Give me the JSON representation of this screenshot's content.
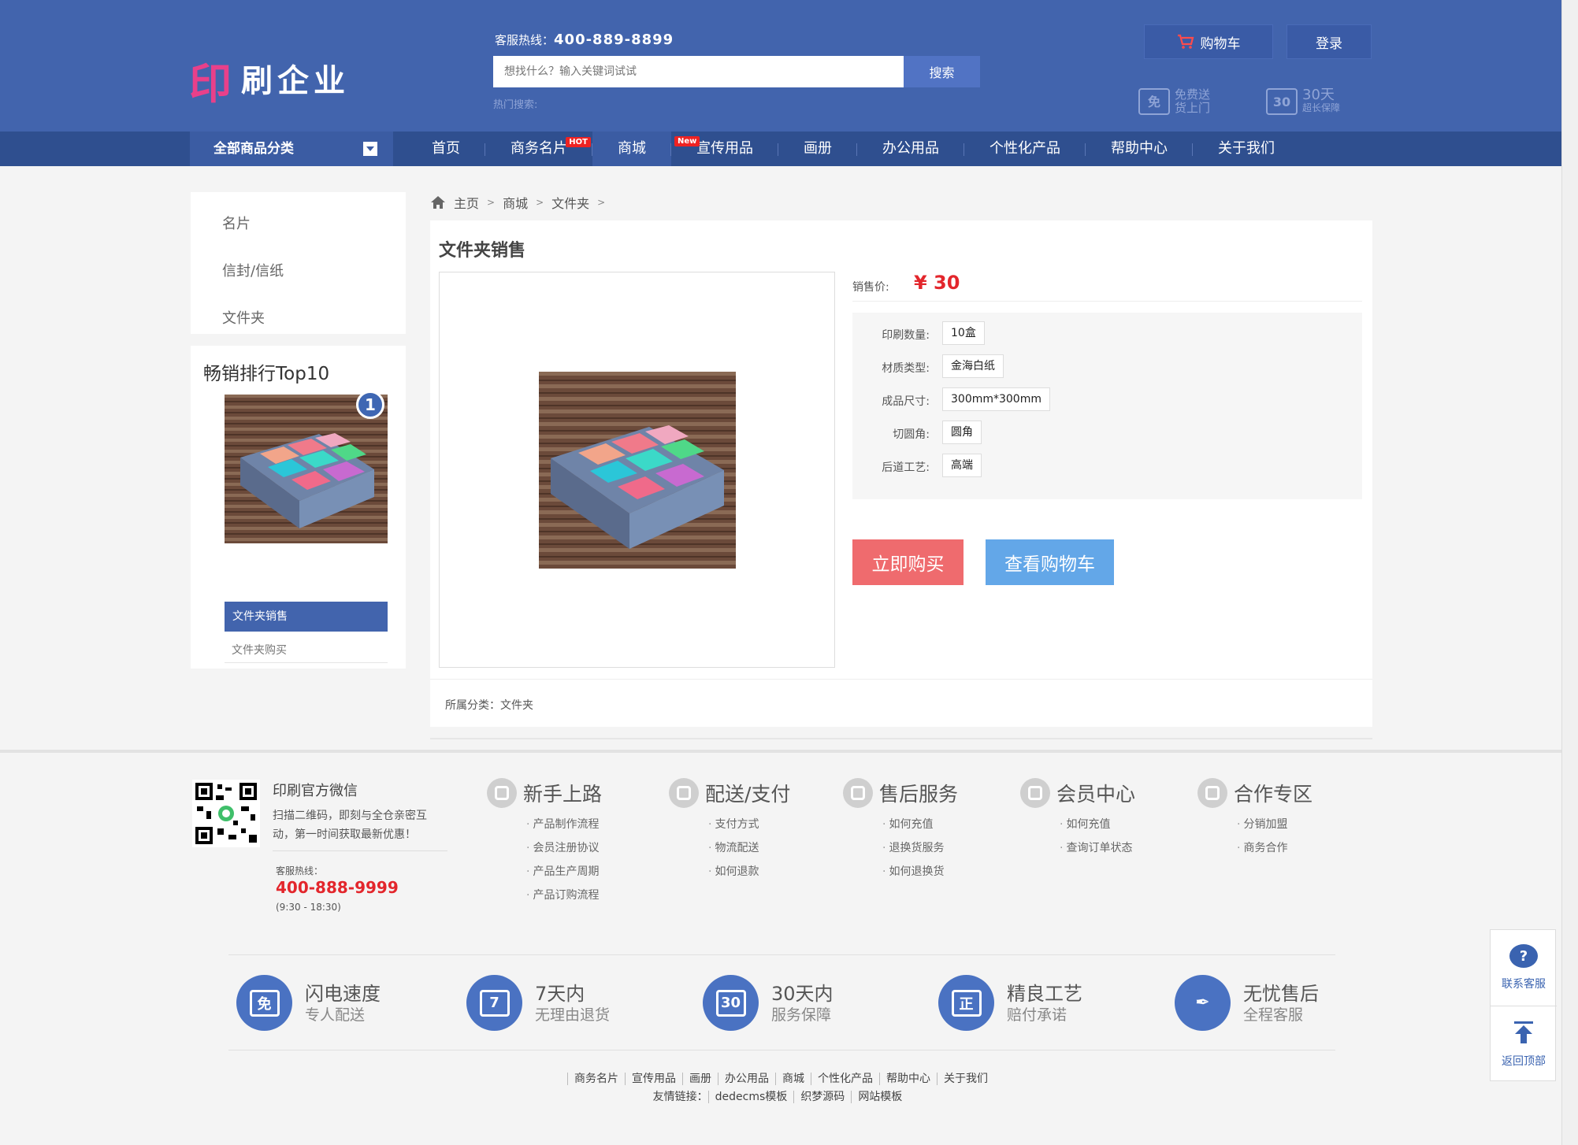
{
  "header": {
    "logo_mark": "印",
    "logo_name": "刷企业",
    "hotline_label": "客服热线：",
    "hotline_number": "400-889-8899",
    "search_placeholder": "想找什么？输入关键词试试",
    "search_button": "搜索",
    "hot_search_label": "热门搜索:",
    "cart_button": "购物车",
    "login_button": "登录",
    "free_delivery_icon_text": "免",
    "free_delivery_line1": "免费送",
    "free_delivery_line2": "货上门",
    "guarantee_icon_text": "30",
    "guarantee_line1": "30天",
    "guarantee_line2": "超长保障"
  },
  "nav": {
    "all_categories": "全部商品分类",
    "items": [
      {
        "label": "首页",
        "tag": ""
      },
      {
        "label": "商务名片",
        "tag": "HOT"
      },
      {
        "label": "商城",
        "tag": ""
      },
      {
        "label": "宣传用品",
        "tag": "New"
      },
      {
        "label": "画册",
        "tag": ""
      },
      {
        "label": "办公用品",
        "tag": ""
      },
      {
        "label": "个性化产品",
        "tag": ""
      },
      {
        "label": "帮助中心",
        "tag": ""
      },
      {
        "label": "关于我们",
        "tag": ""
      }
    ]
  },
  "sidebar": {
    "categories": [
      "名片",
      "信封/信纸",
      "文件夹"
    ],
    "top10_title": "畅销排行Top10",
    "rank_number": "1",
    "top10_items": [
      "文件夹销售",
      "文件夹购买"
    ]
  },
  "breadcrumb": {
    "items": [
      "主页",
      "商城",
      "文件夹"
    ],
    "separator": ">"
  },
  "product": {
    "title": "文件夹销售",
    "price_label": "销售价:",
    "price": "¥ 30",
    "specs": [
      {
        "label": "印刷数量:",
        "value": "10盒"
      },
      {
        "label": "材质类型:",
        "value": "金海白纸"
      },
      {
        "label": "成品尺寸:",
        "value": "300mm*300mm"
      },
      {
        "label": "切圆角:",
        "value": "圆角"
      },
      {
        "label": "后道工艺:",
        "value": "高端"
      }
    ],
    "buy_button": "立即购买",
    "view_cart_button": "查看购物车",
    "category_line": "所属分类：文件夹"
  },
  "footer": {
    "wechat_title": "印刷官方微信",
    "wechat_desc": "扫描二维码，即刻与全仓亲密互动，第一时间获取最新优惠！",
    "service_label": "客服热线：",
    "service_phone": "400-888-9999",
    "service_hours": "(9:30 - 18:30)",
    "columns": [
      {
        "title": "新手上路",
        "links": [
          "产品制作流程",
          "会员注册协议",
          "产品生产周期",
          "产品订购流程"
        ]
      },
      {
        "title": "配送/支付",
        "links": [
          "支付方式",
          "物流配送",
          "如何退款"
        ]
      },
      {
        "title": "售后服务",
        "links": [
          "如何充值",
          "退换货服务",
          "如何退换货"
        ]
      },
      {
        "title": "会员中心",
        "links": [
          "如何充值",
          "查询订单状态"
        ]
      },
      {
        "title": "合作专区",
        "links": [
          "分销加盟",
          "商务合作"
        ]
      }
    ],
    "features": [
      {
        "icon": "免",
        "title": "闪电速度",
        "sub": "专人配送"
      },
      {
        "icon": "7",
        "title": "7天内",
        "sub": "无理由退货"
      },
      {
        "icon": "30",
        "title": "30天内",
        "sub": "服务保障"
      },
      {
        "icon": "正",
        "title": "精良工艺",
        "sub": "赔付承诺"
      },
      {
        "icon": "✒",
        "title": "无忧售后",
        "sub": "全程客服"
      }
    ],
    "bottom_links": [
      "商务名片",
      "宣传用品",
      "画册",
      "办公用品",
      "商城",
      "个性化产品",
      "帮助中心",
      "关于我们"
    ],
    "friend_label": "友情链接：",
    "friend_links": [
      "dedecms模板",
      "织梦源码",
      "网站模板"
    ]
  },
  "float_tools": {
    "service_icon": "?",
    "service_label": "联系客服",
    "top_label": "返回顶部"
  }
}
